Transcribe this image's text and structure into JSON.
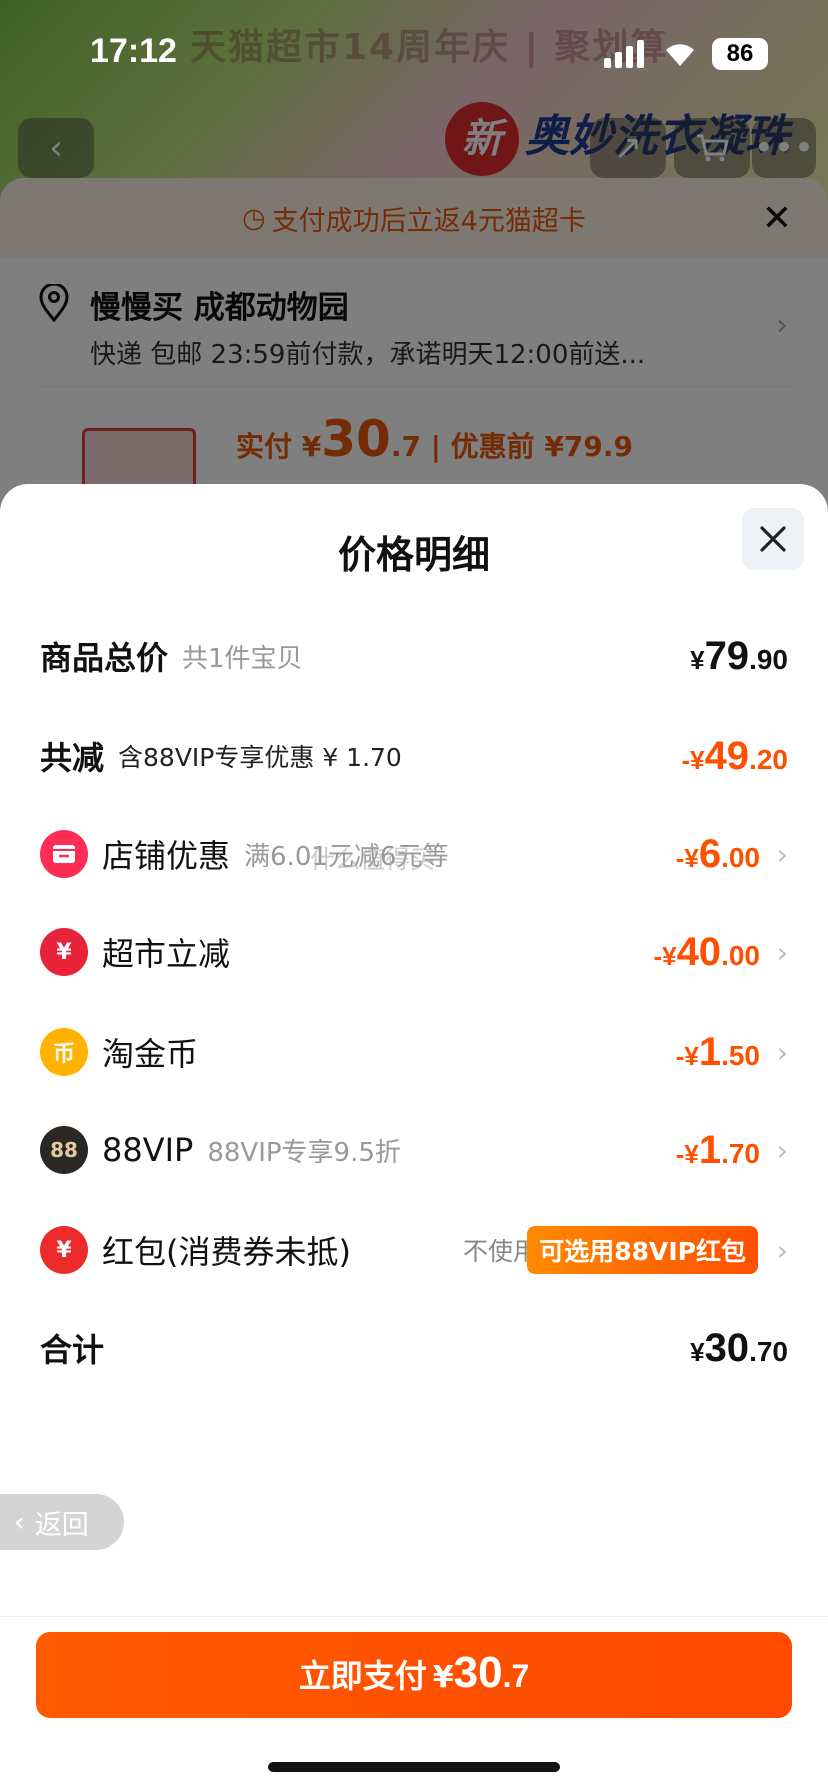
{
  "status": {
    "time": "17:12",
    "battery": "86"
  },
  "background": {
    "banner_text": "天猫超市14周年庆 | 聚划算",
    "brand_new": "新",
    "brand_text": "奥妙洗衣凝珠",
    "notice": "支付成功后立返4元猫超卡",
    "address_name": "慢慢买 成都动物园",
    "address_sub": "快递 包邮 23:59前付款，承诺明天12:00前送...",
    "price_prefix": "实付 ¥",
    "price_big": "30",
    "price_dec": ".7",
    "price_old": " | 优惠前 ¥79.9"
  },
  "modal": {
    "title": "价格明细",
    "rows": {
      "total_goods": {
        "label": "商品总价",
        "sub": "共1件宝贝",
        "cur": "¥",
        "int": "79",
        "dec": ".90"
      },
      "reduction": {
        "label": "共减",
        "sub": "含88VIP专享优惠 ¥ 1.70",
        "cur": "-¥",
        "int": "49",
        "dec": ".20"
      },
      "shop": {
        "label": "店铺优惠",
        "sub": "满6.01元减6元等",
        "cur": "-¥",
        "int": "6",
        "dec": ".00",
        "icon": "shop-icon"
      },
      "market": {
        "label": "超市立减",
        "cur": "-¥",
        "int": "40",
        "dec": ".00",
        "icon": "yen-cut-icon",
        "icon_text": "¥"
      },
      "coin": {
        "label": "淘金币",
        "cur": "-¥",
        "int": "1",
        "dec": ".50",
        "icon": "coin-icon",
        "icon_text": "币"
      },
      "vip": {
        "label": "88VIP",
        "sub": "88VIP专享9.5折",
        "cur": "-¥",
        "int": "1",
        "dec": ".70",
        "icon": "vip-icon",
        "icon_text": "88"
      },
      "redpacket": {
        "label": "红包(消费券未抵)",
        "nouse": "不使用",
        "pill": "可选用88VIP红包",
        "icon": "red-packet-icon",
        "icon_text": "¥"
      },
      "sum": {
        "label": "合计",
        "cur": "¥",
        "int": "30",
        "dec": ".70"
      }
    }
  },
  "watermark": "什么值得买",
  "back_label": "返回",
  "pay": {
    "label": "立即支付",
    "cur": "¥",
    "int": "30",
    "dec": ".7"
  },
  "colors": {
    "accent": "#ff5000",
    "pill": "#ff8a00"
  }
}
